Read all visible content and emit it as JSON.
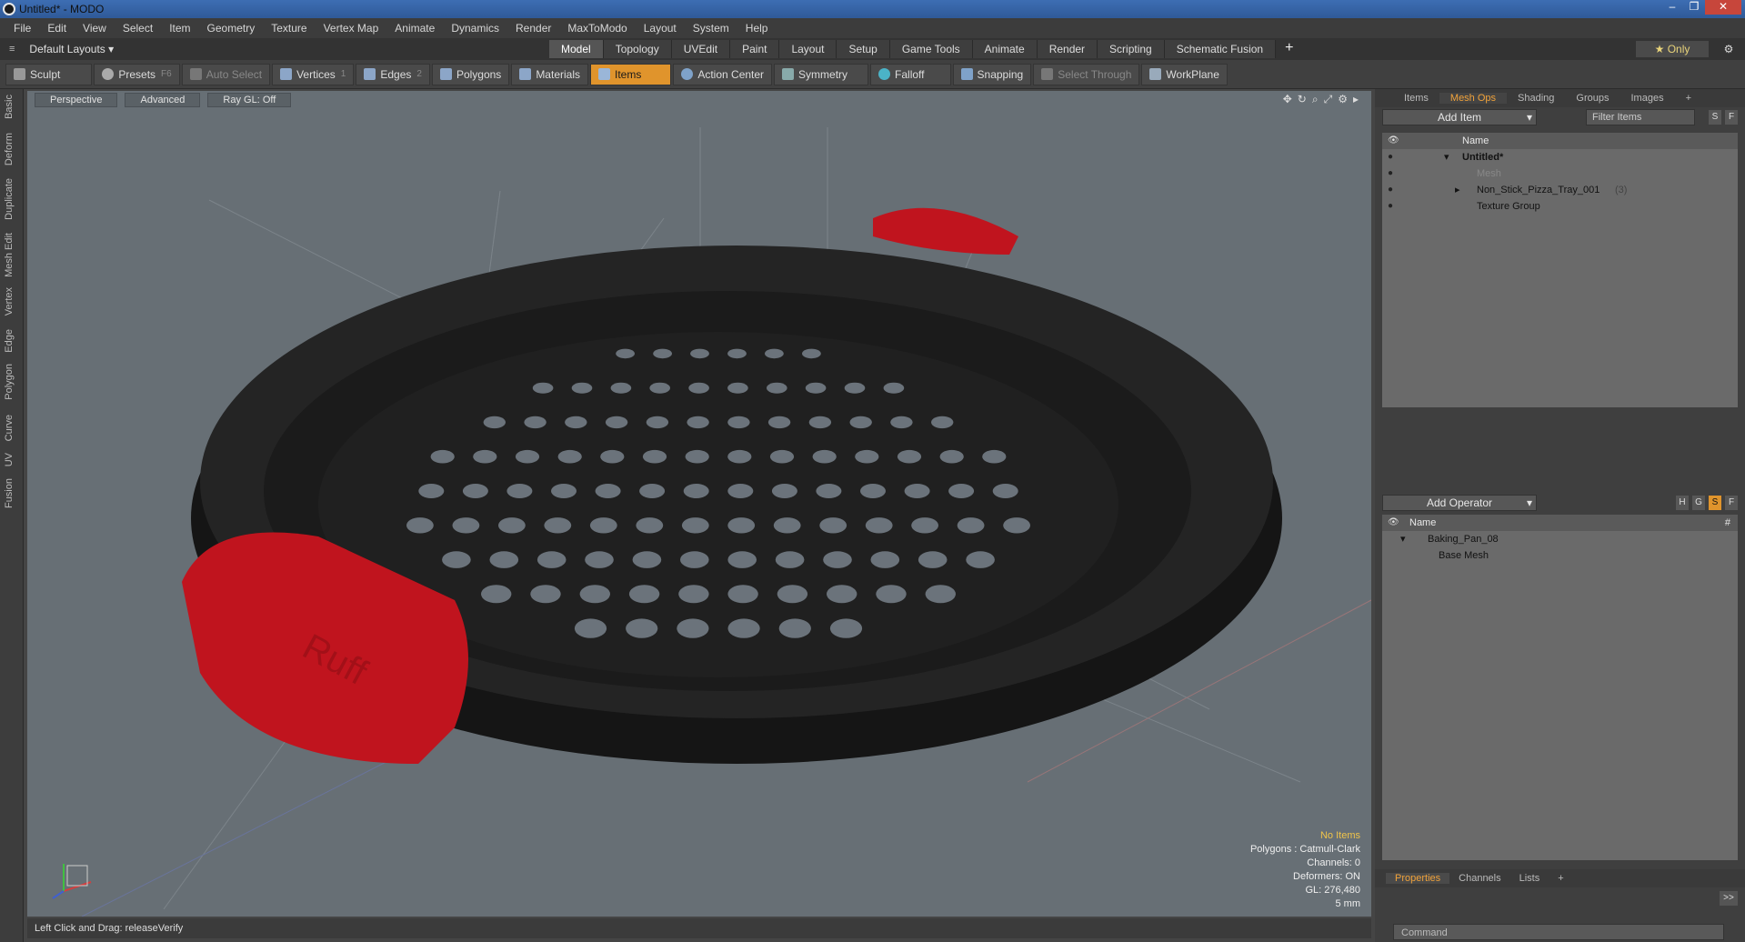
{
  "window": {
    "title": "Untitled* - MODO"
  },
  "menu": [
    "File",
    "Edit",
    "View",
    "Select",
    "Item",
    "Geometry",
    "Texture",
    "Vertex Map",
    "Animate",
    "Dynamics",
    "Render",
    "MaxToModo",
    "Layout",
    "System",
    "Help"
  ],
  "layouts": {
    "label": "Default Layouts ▾"
  },
  "tabs": [
    "Model",
    "Topology",
    "UVEdit",
    "Paint",
    "Layout",
    "Setup",
    "Game Tools",
    "Animate",
    "Render",
    "Scripting",
    "Schematic Fusion"
  ],
  "tabs_plus": "+",
  "only_btn": "★ Only",
  "toolbar": {
    "sculpt": "Sculpt",
    "presets": "Presets",
    "presets_sc": "F6",
    "auto_select": "Auto Select",
    "vertices": "Vertices",
    "vertices_sc": "1",
    "edges": "Edges",
    "edges_sc": "2",
    "polygons": "Polygons",
    "materials": "Materials",
    "items": "Items",
    "action_center": "Action Center",
    "symmetry": "Symmetry",
    "falloff": "Falloff",
    "snapping": "Snapping",
    "select_through": "Select Through",
    "workplane": "WorkPlane"
  },
  "left_tabs": [
    "Basic",
    "Deform",
    "Duplicate",
    "Mesh Edit",
    "Vertex",
    "Edge",
    "Polygon",
    "Curve",
    "UV",
    "Fusion"
  ],
  "viewport": {
    "perspective": "Perspective",
    "advanced": "Advanced",
    "raygl": "Ray GL: Off",
    "info": {
      "no_items": "No Items",
      "polygons": "Polygons : Catmull-Clark",
      "channels": "Channels: 0",
      "deformers": "Deformers: ON",
      "gl": "GL: 276,480",
      "scale": "5 mm"
    },
    "handle_logo": "Ruff"
  },
  "status": {
    "text": "Left Click and Drag:   releaseVerify"
  },
  "right_panel": {
    "top_tabs": [
      "Items",
      "Mesh Ops",
      "Shading",
      "Groups",
      "Images",
      "+"
    ],
    "add_item": "Add Item",
    "filter_items": "Filter Items",
    "s_btn": "S",
    "f_btn": "F",
    "items_header": "Name",
    "items": [
      {
        "name": "Untitled*",
        "bold": true
      },
      {
        "name": "Mesh",
        "dim": true
      },
      {
        "name": "Non_Stick_Pizza_Tray_001",
        "count": "(3)"
      },
      {
        "name": "Texture Group"
      }
    ],
    "add_operator": "Add Operator",
    "op_btns": [
      "H",
      "G",
      "S",
      "F"
    ],
    "ops_header": "Name",
    "ops_hash": "#",
    "ops": [
      {
        "name": "Baking_Pan_08"
      },
      {
        "name": "Base Mesh"
      }
    ],
    "bottom_tabs": [
      "Properties",
      "Channels",
      "Lists",
      "+"
    ],
    "command": "Command",
    "expand": ">>"
  },
  "colors": {
    "accent": "#e0942c",
    "tray": "#1e1e1e",
    "handle": "#c0141e",
    "viewport": "#676f75"
  }
}
